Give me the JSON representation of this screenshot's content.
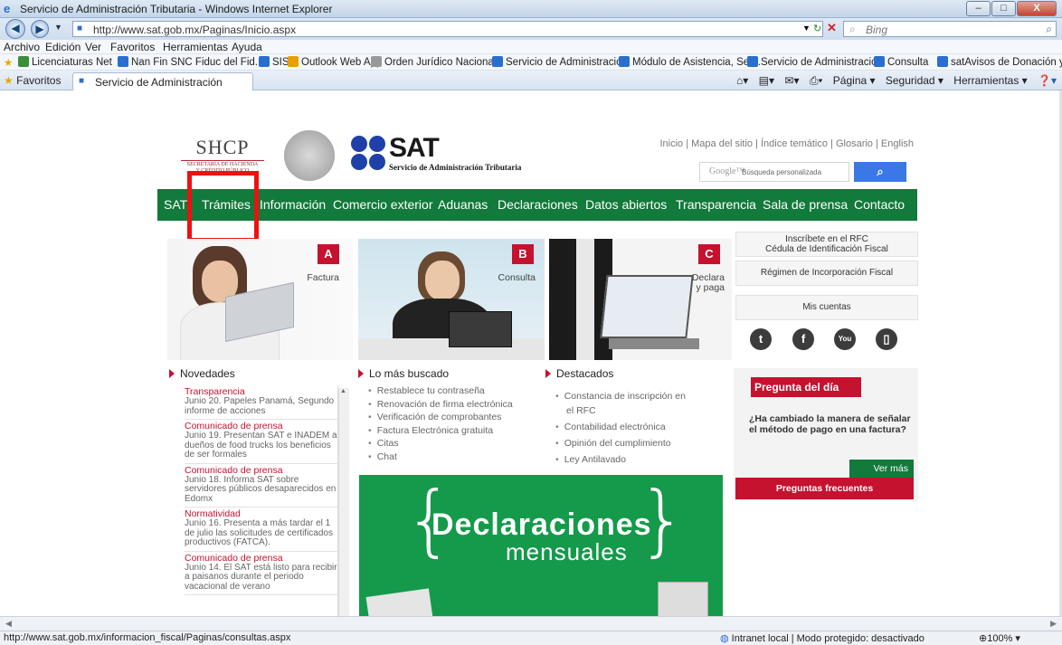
{
  "window": {
    "title": "Servicio de Administración Tributaria - Windows Internet Explorer",
    "minimize": "–",
    "maximize": "□",
    "close": "X"
  },
  "address": {
    "url": "http://www.sat.gob.mx/Paginas/Inicio.aspx",
    "search_placeholder": "Bing"
  },
  "menu": [
    "Archivo",
    "Edición",
    "Ver",
    "Favoritos",
    "Herramientas",
    "Ayuda"
  ],
  "favorites_bar": [
    {
      "label": "Licenciaturas Net",
      "color": "#3a8e3a"
    },
    {
      "label": "Nan Fin SNC Fiduc del Fid...",
      "color": "#2a6ed0"
    },
    {
      "label": "SIS",
      "color": "#2a6ed0"
    },
    {
      "label": "Outlook Web App",
      "color": "#e8a000"
    },
    {
      "label": "Orden Jurídico Nacional",
      "color": "#888888"
    },
    {
      "label": "Servicio de Administració...",
      "color": "#2a6ed0"
    },
    {
      "label": "Módulo de Asistencia, Ser...",
      "color": "#2a6ed0"
    },
    {
      "label": "Servicio de Administració...",
      "color": "#2a6ed0"
    },
    {
      "label": "Consulta",
      "color": "#2a6ed0"
    },
    {
      "label": "satAvisos de Donación y ...",
      "color": "#2a6ed0"
    }
  ],
  "tabbar": {
    "favoritos": "Favoritos",
    "tab_title": "Servicio de Administración Tributaria",
    "commands": [
      "Página ▾",
      "Seguridad ▾",
      "Herramientas ▾"
    ]
  },
  "page": {
    "shcp": {
      "big": "SHCP",
      "small1": "SECRETARÍA DE HACIENDA",
      "small2": "Y CRÉDITO PÚBLICO"
    },
    "sat": {
      "word": "SAT",
      "sub": "Servicio de Administración Tributaria"
    },
    "toplinks": [
      "Inicio",
      "Mapa del sitio",
      "Índice temático",
      "Glosario",
      "English"
    ],
    "google": {
      "brand": "Google™",
      "placeholder": "Búsqueda personalizada",
      "button_icon": "search-icon"
    },
    "nav": [
      "SAT",
      "Trámites",
      "Información",
      "Comercio exterior",
      "Aduanas",
      "Declaraciones",
      "Datos abiertos",
      "Transparencia",
      "Sala de prensa",
      "Contacto"
    ],
    "banners": [
      {
        "letter": "A",
        "caption": "Factura"
      },
      {
        "letter": "B",
        "caption": "Consulta"
      },
      {
        "letter": "C",
        "caption_line1": "Declara",
        "caption_line2": "y paga"
      }
    ],
    "right_buttons": {
      "rfc_line1": "Inscríbete en el RFC",
      "rfc_line2": "Cédula de Identificación Fiscal",
      "regimen": "Régimen de Incorporación Fiscal",
      "cuentas": "Mis cuentas"
    },
    "social": [
      {
        "icon": "twitter-icon",
        "glyph": "t"
      },
      {
        "icon": "facebook-icon",
        "glyph": "f"
      },
      {
        "icon": "youtube-icon",
        "glyph": "You"
      },
      {
        "icon": "apps-icon",
        "glyph": "▯"
      }
    ],
    "novedades": {
      "title": "Novedades",
      "items": [
        {
          "cat": "Transparencia",
          "text": "Junio 20. Papeles Panamá, Segundo informe de acciones"
        },
        {
          "cat": "Comunicado de prensa",
          "text": "Junio 19. Presentan SAT e INADEM a dueños de food trucks los beneficios de ser formales"
        },
        {
          "cat": "Comunicado de prensa",
          "text": "Junio 18. Informa SAT sobre servidores públicos desaparecidos en Edomx"
        },
        {
          "cat": "Normatividad",
          "text": "Junio 16. Presenta a más tardar el 1 de julio las solicitudes de certificados productivos (FATCA)."
        },
        {
          "cat": "Comunicado de prensa",
          "text": "Junio 14. El SAT está listo para recibir a paisanos durante el periodo vacacional de verano"
        }
      ]
    },
    "buscado": {
      "title": "Lo más buscado",
      "items": [
        "Restablece tu contraseña",
        "Renovación de firma electrónica",
        "Verificación de comprobantes",
        "Factura Electrónica gratuita",
        "Citas",
        "Chat"
      ]
    },
    "destacados": {
      "title": "Destacados",
      "items": [
        "Constancia de inscripción en el RFC",
        "Contabilidad electrónica",
        "Opinión del cumplimiento",
        "Ley Antilavado"
      ]
    },
    "pregunta": {
      "title": "Pregunta del día",
      "question": "¿Ha cambiado la manera de señalar el método de pago en una factura?",
      "vermas": "Ver más",
      "frecuentes": "Preguntas frecuentes"
    },
    "declaraciones": {
      "line1": "Declaraciones",
      "line2": "mensuales"
    }
  },
  "status": {
    "url": "http://www.sat.gob.mx/informacion_fiscal/Paginas/consultas.aspx",
    "zone": "Intranet local | Modo protegido: desactivado",
    "zoom": "100%"
  },
  "colors": {
    "sat_green": "#127a3a",
    "sat_red": "#c4122f",
    "highlight": "#ee1111"
  }
}
